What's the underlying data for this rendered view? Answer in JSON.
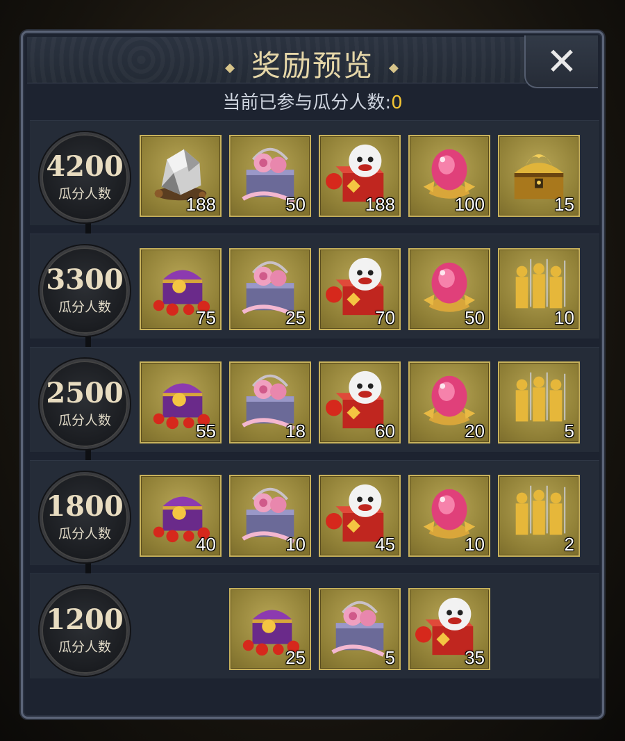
{
  "title": "奖励预览",
  "participants": {
    "label": "当前已参与瓜分人数:",
    "count": "0"
  },
  "tier_label": "瓜分人数",
  "icons": {
    "ore": "ore-rock-icon",
    "box": "rose-gift-box-icon",
    "lion": "lion-gift-box-icon",
    "gem": "pink-lotus-gem-icon",
    "dchest": "golden-dragon-chest-icon",
    "chest": "treasure-chest-icon",
    "soldiers": "golden-soldiers-icon"
  },
  "tiers": [
    {
      "num": "4200",
      "items": [
        {
          "icon": "ore",
          "qty": "188"
        },
        {
          "icon": "box",
          "qty": "50"
        },
        {
          "icon": "lion",
          "qty": "188"
        },
        {
          "icon": "gem",
          "qty": "100"
        },
        {
          "icon": "dchest",
          "qty": "15"
        }
      ]
    },
    {
      "num": "3300",
      "items": [
        {
          "icon": "chest",
          "qty": "75"
        },
        {
          "icon": "box",
          "qty": "25"
        },
        {
          "icon": "lion",
          "qty": "70"
        },
        {
          "icon": "gem",
          "qty": "50"
        },
        {
          "icon": "soldiers",
          "qty": "10"
        }
      ]
    },
    {
      "num": "2500",
      "items": [
        {
          "icon": "chest",
          "qty": "55"
        },
        {
          "icon": "box",
          "qty": "18"
        },
        {
          "icon": "lion",
          "qty": "60"
        },
        {
          "icon": "gem",
          "qty": "20"
        },
        {
          "icon": "soldiers",
          "qty": "5"
        }
      ]
    },
    {
      "num": "1800",
      "items": [
        {
          "icon": "chest",
          "qty": "40"
        },
        {
          "icon": "box",
          "qty": "10"
        },
        {
          "icon": "lion",
          "qty": "45"
        },
        {
          "icon": "gem",
          "qty": "10"
        },
        {
          "icon": "soldiers",
          "qty": "2"
        }
      ]
    },
    {
      "num": "1200",
      "items": [
        null,
        {
          "icon": "chest",
          "qty": "25"
        },
        {
          "icon": "box",
          "qty": "5"
        },
        {
          "icon": "lion",
          "qty": "35"
        },
        null
      ]
    }
  ]
}
